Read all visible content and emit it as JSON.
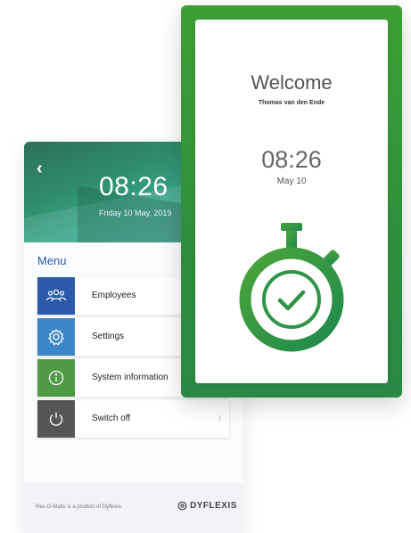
{
  "menu_screen": {
    "back_icon": "chevron-left-icon",
    "time": "08:26",
    "date": "Friday 10 May, 2019",
    "menu_title": "Menu",
    "items": [
      {
        "label": "Employees",
        "icon": "people-icon",
        "color": "#2a5aa8"
      },
      {
        "label": "Settings",
        "icon": "gear-icon",
        "color": "#3b86c8"
      },
      {
        "label": "System information",
        "icon": "info-icon",
        "color": "#4e9a45"
      },
      {
        "label": "Switch off",
        "icon": "power-icon",
        "color": "#555555"
      }
    ],
    "footer_credit": "Res-O-Matic is a product of Dyflexis",
    "brand": "DYFLEXIS"
  },
  "welcome_screen": {
    "title": "Welcome",
    "user_name": "Thomas van den Ende",
    "time": "08:26",
    "date": "May 10",
    "icon": "stopwatch-check-icon",
    "accent": "#3a9a3c"
  }
}
